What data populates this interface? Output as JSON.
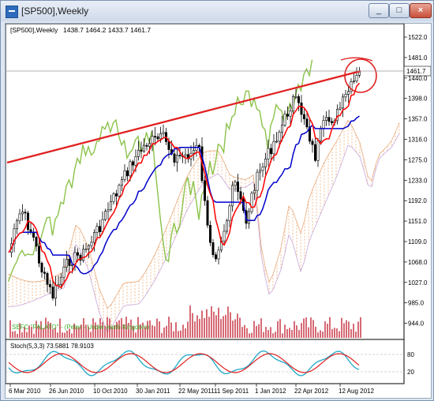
{
  "window": {
    "title": "[SP500],Weekly",
    "buttons": {
      "minimize": "_",
      "maximize": "□",
      "close": "×"
    }
  },
  "chart_header": {
    "symbol_tf": "[SP500],Weekly",
    "ohlc": "1438.7 1464.2 1433.7 1461.7"
  },
  "price_axis": {
    "ticks": [
      "1522.0",
      "1481.0",
      "1440.0",
      "1398.0",
      "1357.0",
      "1316.0",
      "1275.0",
      "1233.0",
      "1192.0",
      "1151.0",
      "1109.0",
      "1068.0",
      "1027.0",
      "985.0",
      "944.0"
    ],
    "current_price": "1461.7"
  },
  "time_axis": {
    "labels": [
      "6 Mar 2010",
      "26 Jun 2010",
      "10 Oct 2010",
      "30 Jan 2011",
      "22 May 2011",
      "11 Sep 2011",
      "1 Jan 2012",
      "22 Apr 2012",
      "12 Aug 2012"
    ]
  },
  "volume_label": "SEFC \"PALATO\" - (Peter - Under earth Kingdom)",
  "stochastic": {
    "label": "Stoch(5,3,3) 73.5881 78.9103",
    "ticks": [
      "80",
      "20"
    ]
  },
  "colors": {
    "background": "#ffffff",
    "candle": "#000000",
    "tenkan": "#ff0000",
    "kijun": "#0000cc",
    "chikou": "#8bc34a",
    "cloud": "#f3c9a4",
    "trendline": "#e02020",
    "volume": "#c0192b",
    "stoch_main": "#1fa8c9",
    "stoch_signal": "#e02020"
  }
}
